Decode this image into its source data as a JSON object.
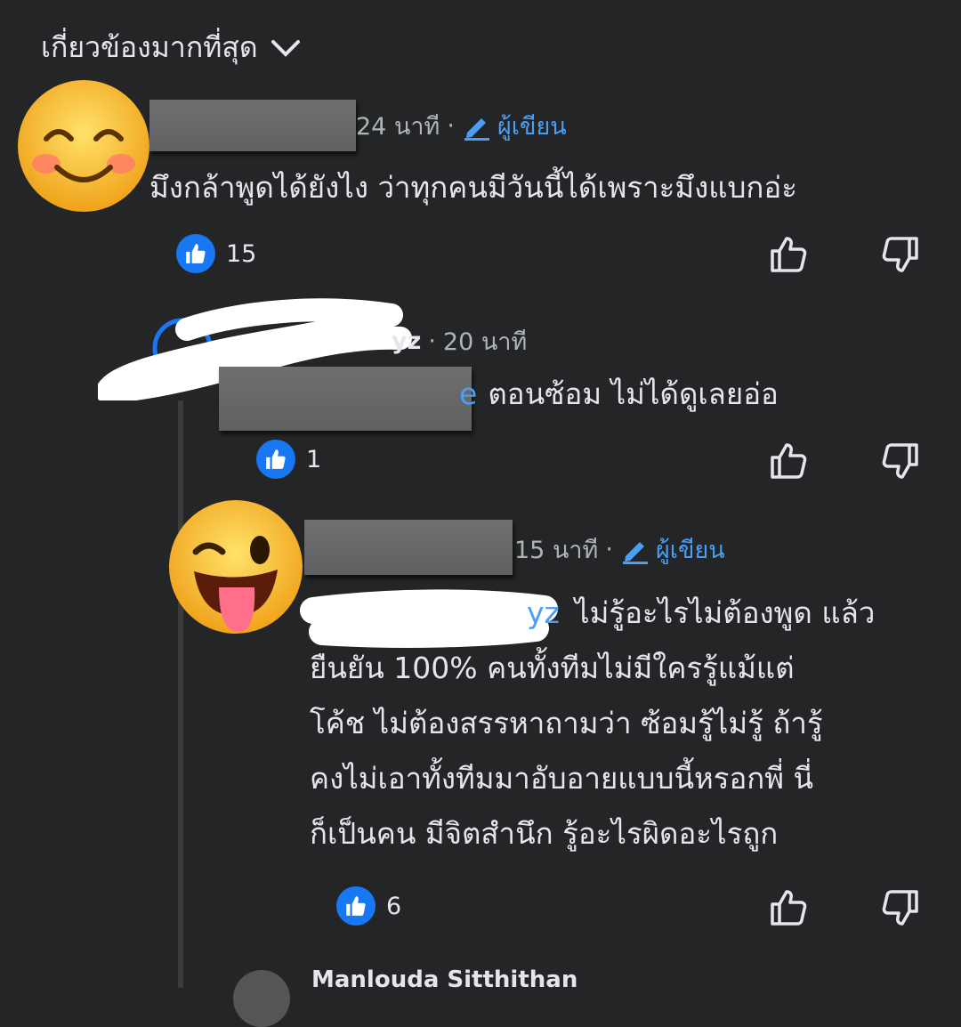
{
  "sort_label": "เกี่ยวข้องมากที่สุด",
  "comments": [
    {
      "time": "24 นาที",
      "author_badge": "ผู้เขียน",
      "text": "มึงกล้าพูดได้ยังไง ว่าทุกคนมีวันนี้ได้เพราะมึงแบกอ่ะ",
      "likes": "15"
    },
    {
      "name_tail": "yz",
      "time": "20 นาที",
      "mention_tail": "e",
      "text": "ตอนซ้อม ไม่ได้ดูเลยอ่อ",
      "likes": "1"
    },
    {
      "time": "15 นาที",
      "author_badge": "ผู้เขียน",
      "mention_tail": "yz",
      "text_lines": [
        "ไม่รู้อะไรไม่ต้องพูด แล้ว",
        "ยืนยัน 100% คนทั้งทีมไม่มีใครรู้แม้แต่",
        "โค้ช ไม่ต้องสรรหาถามว่า ซ้อมรู้ไม่รู้ ถ้ารู้",
        "คงไม่เอาทั้งทีมมาอับอายแบบนี้หรอกพี่ นี่",
        "ก็เป็นคน มีจิตสำนึก รู้อะไรผิดอะไรถูก"
      ],
      "likes": "6"
    }
  ],
  "next_name_partial": "Manlouda Sitthithan",
  "icons": {
    "sort": "chevron-down-icon",
    "author": "pencil-icon",
    "like": "thumbs-up-icon",
    "dislike": "thumbs-down-icon",
    "avatar1": "smiling-face-emoji",
    "avatar3": "winking-tongue-emoji"
  },
  "colors": {
    "background": "#242526",
    "accent": "#1877f2",
    "link": "#4b9ef5"
  }
}
